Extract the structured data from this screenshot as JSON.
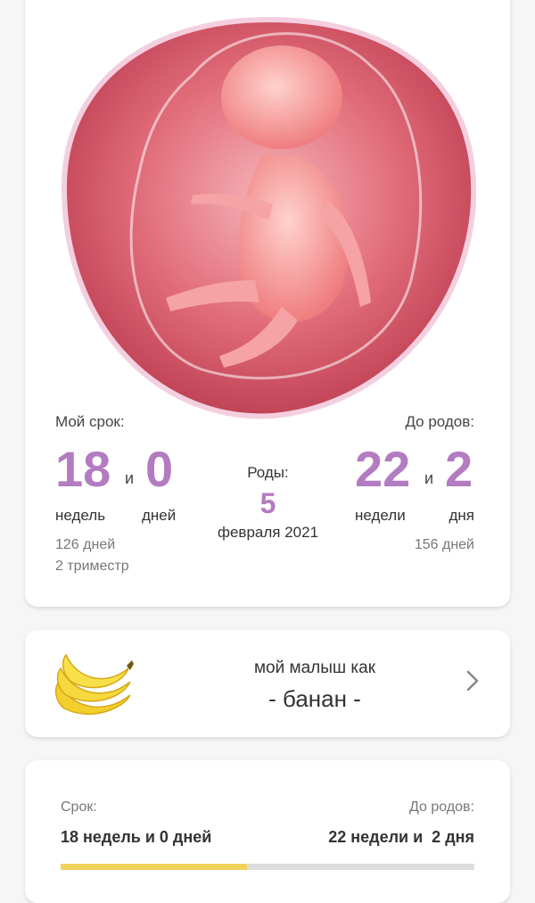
{
  "summary": {
    "my_term_label": "Мой срок:",
    "due_label": "До родов:",
    "weeks": "18",
    "and1": "и",
    "days": "0",
    "weeks_unit": "недель",
    "days_unit": "дней",
    "total_days": "126 дней",
    "trimester": "2 триместр",
    "birth_label": "Роды:",
    "birth_day": "5",
    "birth_month_year": "февраля 2021",
    "left_weeks": "22",
    "and2": "и",
    "left_days": "2",
    "left_weeks_unit": "недели",
    "left_days_unit": "дня",
    "left_total_days": "156 дней"
  },
  "fruit": {
    "title": "мой малыш как",
    "name": "- банан -",
    "icon": "banana-icon"
  },
  "progress": {
    "term_label": "Срок:",
    "term_value": "18 недель и 0 дней",
    "due_label": "До родов:",
    "due_value": "22 недели и  2 дня",
    "fraction": 0.45
  },
  "colors": {
    "accent": "#b37bc0",
    "progress_fill": "#f2d25a",
    "progress_track": "#dedede"
  }
}
